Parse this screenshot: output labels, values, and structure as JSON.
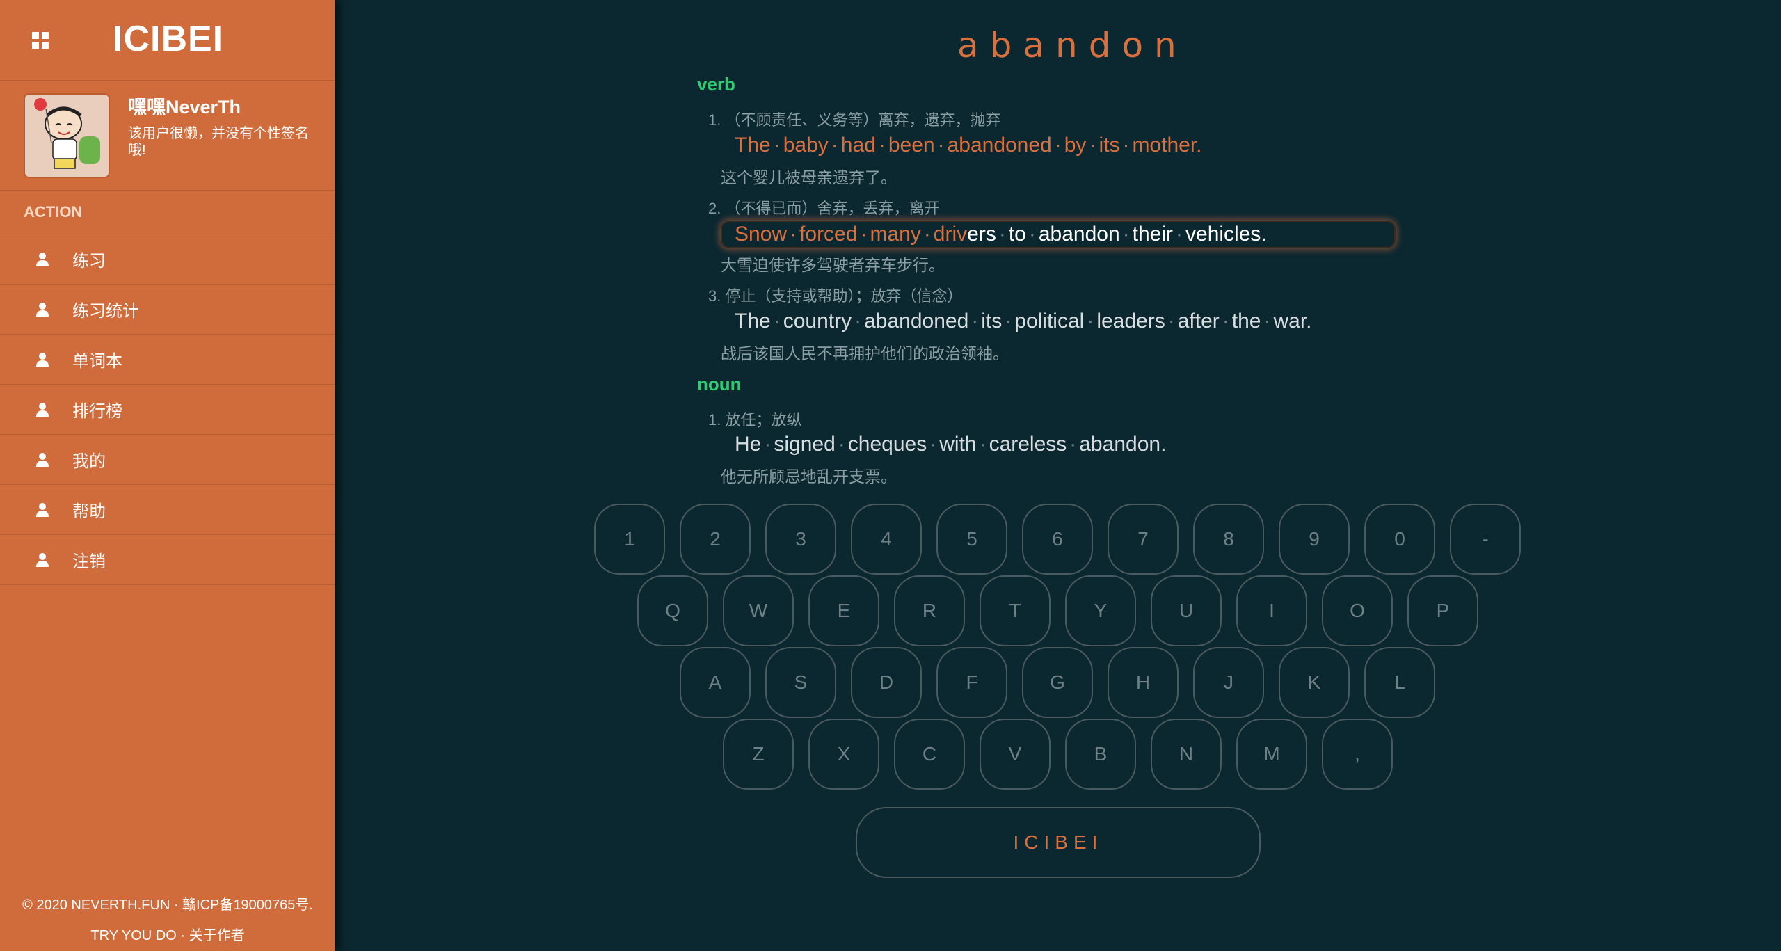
{
  "sidebar": {
    "app_title": "ICIBEI",
    "menu_icon": "grid-icon",
    "user": {
      "name": "嘿嘿NeverTh",
      "bio": "该用户很懒，并没有个性签名哦!"
    },
    "section_label": "ACTION",
    "items": [
      {
        "label": "练习",
        "icon": "person-icon"
      },
      {
        "label": "练习统计",
        "icon": "person-icon"
      },
      {
        "label": "单词本",
        "icon": "person-icon"
      },
      {
        "label": "排行榜",
        "icon": "person-icon"
      },
      {
        "label": "我的",
        "icon": "person-icon"
      },
      {
        "label": "帮助",
        "icon": "person-icon"
      },
      {
        "label": "注销",
        "icon": "person-icon"
      }
    ],
    "footer": {
      "line1": "© 2020 NEVERTH.FUN · 赣ICP备19000765号.",
      "try_label": "TRY YOU DO",
      "sep": " · ",
      "about_label": "关于作者"
    }
  },
  "word": "abandon",
  "senses": {
    "verb": {
      "pos": "verb",
      "defs": [
        {
          "num": "1.",
          "def": "（不顾责任、义务等）离弃，遗弃，抛弃",
          "example": [
            "The",
            "baby",
            "had",
            "been",
            "abandoned",
            "by",
            "its",
            "mother."
          ],
          "typed_chars": 46,
          "translation": "这个婴儿被母亲遗弃了。"
        },
        {
          "num": "2.",
          "def": "（不得已而）舍弃，丢弃，离开",
          "example": [
            "Snow",
            "forced",
            "many",
            "drivers",
            "to",
            "abandon",
            "their",
            "vehicles."
          ],
          "typed_chars": 21,
          "translation": "大雪迫使许多驾驶者弃车步行。"
        },
        {
          "num": "3.",
          "def": "停止（支持或帮助）；放弃（信念）",
          "example": [
            "The",
            "country",
            "abandoned",
            "its",
            "political",
            "leaders",
            "after",
            "the",
            "war."
          ],
          "typed_chars": 0,
          "translation": "战后该国人民不再拥护他们的政治领袖。"
        }
      ]
    },
    "noun": {
      "pos": "noun",
      "defs": [
        {
          "num": "1.",
          "def": "放任；放纵",
          "example": [
            "He",
            "signed",
            "cheques",
            "with",
            "careless",
            "abandon."
          ],
          "typed_chars": 0,
          "translation": "他无所顾忌地乱开支票。"
        }
      ]
    }
  },
  "keyboard": {
    "rows": [
      [
        "1",
        "2",
        "3",
        "4",
        "5",
        "6",
        "7",
        "8",
        "9",
        "0",
        "-"
      ],
      [
        "Q",
        "W",
        "E",
        "R",
        "T",
        "Y",
        "U",
        "I",
        "O",
        "P"
      ],
      [
        "A",
        "S",
        "D",
        "F",
        "G",
        "H",
        "J",
        "K",
        "L"
      ],
      [
        "Z",
        "X",
        "C",
        "V",
        "B",
        "N",
        "M",
        ","
      ]
    ],
    "space_label": "ICIBEI"
  },
  "colors": {
    "sidebar": "#d06b3b",
    "background": "#0b2730",
    "accent": "#d9703f",
    "pos_label": "#2ecc71",
    "muted": "#8a9ea3"
  }
}
